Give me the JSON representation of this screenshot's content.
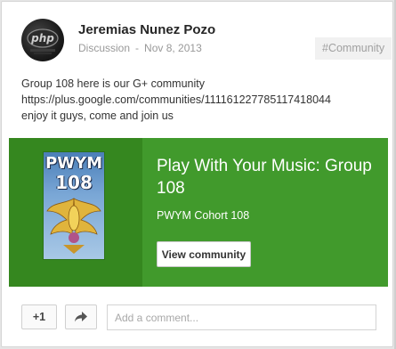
{
  "post": {
    "author": "Jeremias Nunez Pozo",
    "category": "Discussion",
    "date": "Nov 8, 2013",
    "separator": "-",
    "hashtag": "#Community",
    "avatar_text": "php",
    "text_lines": [
      "Group 108 here is our G+ community",
      "https://plus.google.com/communities/111161227785117418044",
      "enjoy it guys, come and join us"
    ]
  },
  "share": {
    "poster_line1": "PWYM",
    "poster_line2": "108",
    "title": "Play With Your Music: Group 108",
    "subtitle": "PWYM Cohort 108",
    "button_label": "View community",
    "accent_color": "#419a2c"
  },
  "actions": {
    "plus_label": "+1",
    "share_icon": "share-arrow-icon",
    "comment_placeholder": "Add a comment..."
  }
}
